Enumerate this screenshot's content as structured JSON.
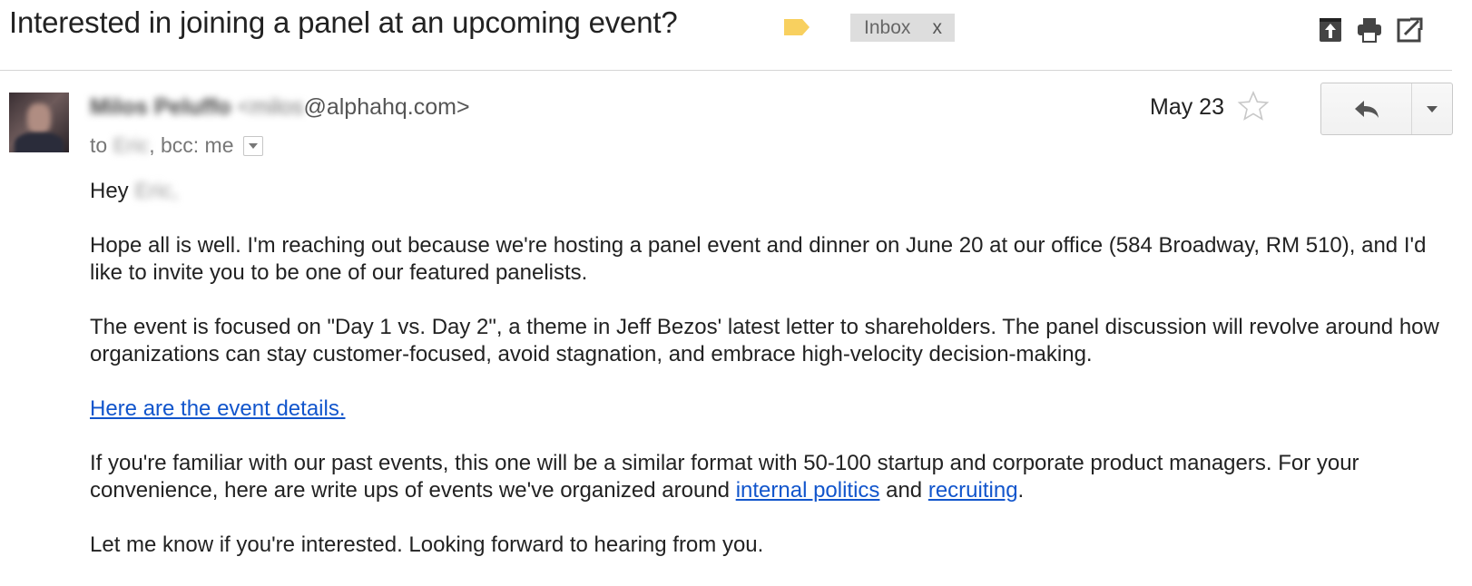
{
  "subject": "Interested in joining a panel at an upcoming event?",
  "label_color": "#f8d05f",
  "inbox_chip": {
    "label": "Inbox",
    "remove": "x"
  },
  "header_icons": [
    "move-to-inbox-icon",
    "print-icon",
    "open-in-new-window-icon"
  ],
  "sender": {
    "name": "Milos Peluffo",
    "email_local": "<milos",
    "email_domain": "@alphahq.com>"
  },
  "recipients": {
    "to_prefix": "to",
    "to_name": "Eric",
    "bcc": ", bcc: me"
  },
  "date": "May 23",
  "body": {
    "greeting": "Hey",
    "greeting_name": "Eric,",
    "p1": "Hope all is well. I'm reaching out because we're hosting a panel event and dinner on June 20 at our office (584 Broadway, RM 510), and I'd like to invite you to be one of our featured panelists.",
    "p2": "The event is focused on \"Day 1 vs. Day 2\", a theme in Jeff Bezos' latest letter to shareholders. The panel discussion will revolve around how organizations can stay customer-focused, avoid stagnation, and embrace high-velocity decision-making.",
    "event_link": "Here are the event details.",
    "p4_a": "If you're familiar with our past events, this one will be a similar format with 50-100 startup and corporate product managers. For your convenience, here are write ups of events we've organized around ",
    "link_politics": "internal politics",
    "p4_and": " and ",
    "link_recruiting": "recruiting",
    "p4_end": ".",
    "p5": "Let me know if you're interested. Looking forward to hearing from you."
  }
}
